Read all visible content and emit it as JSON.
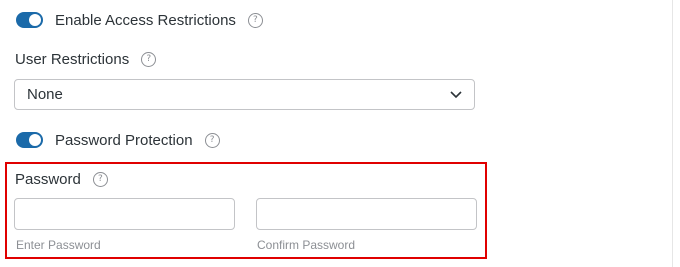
{
  "access": {
    "enable_label": "Enable Access Restrictions",
    "enabled": true
  },
  "user_restrictions": {
    "label": "User Restrictions",
    "selected": "None"
  },
  "password_protection": {
    "label": "Password Protection",
    "enabled": true
  },
  "password": {
    "label": "Password",
    "enter_label": "Enter Password",
    "confirm_label": "Confirm Password",
    "enter_value": "",
    "confirm_value": ""
  },
  "icons": {
    "help": "help-circle-icon",
    "select_arrow": "chevron-down-icon"
  },
  "colors": {
    "toggle_on": "#1b6aa9",
    "highlight_border": "#e00000"
  }
}
